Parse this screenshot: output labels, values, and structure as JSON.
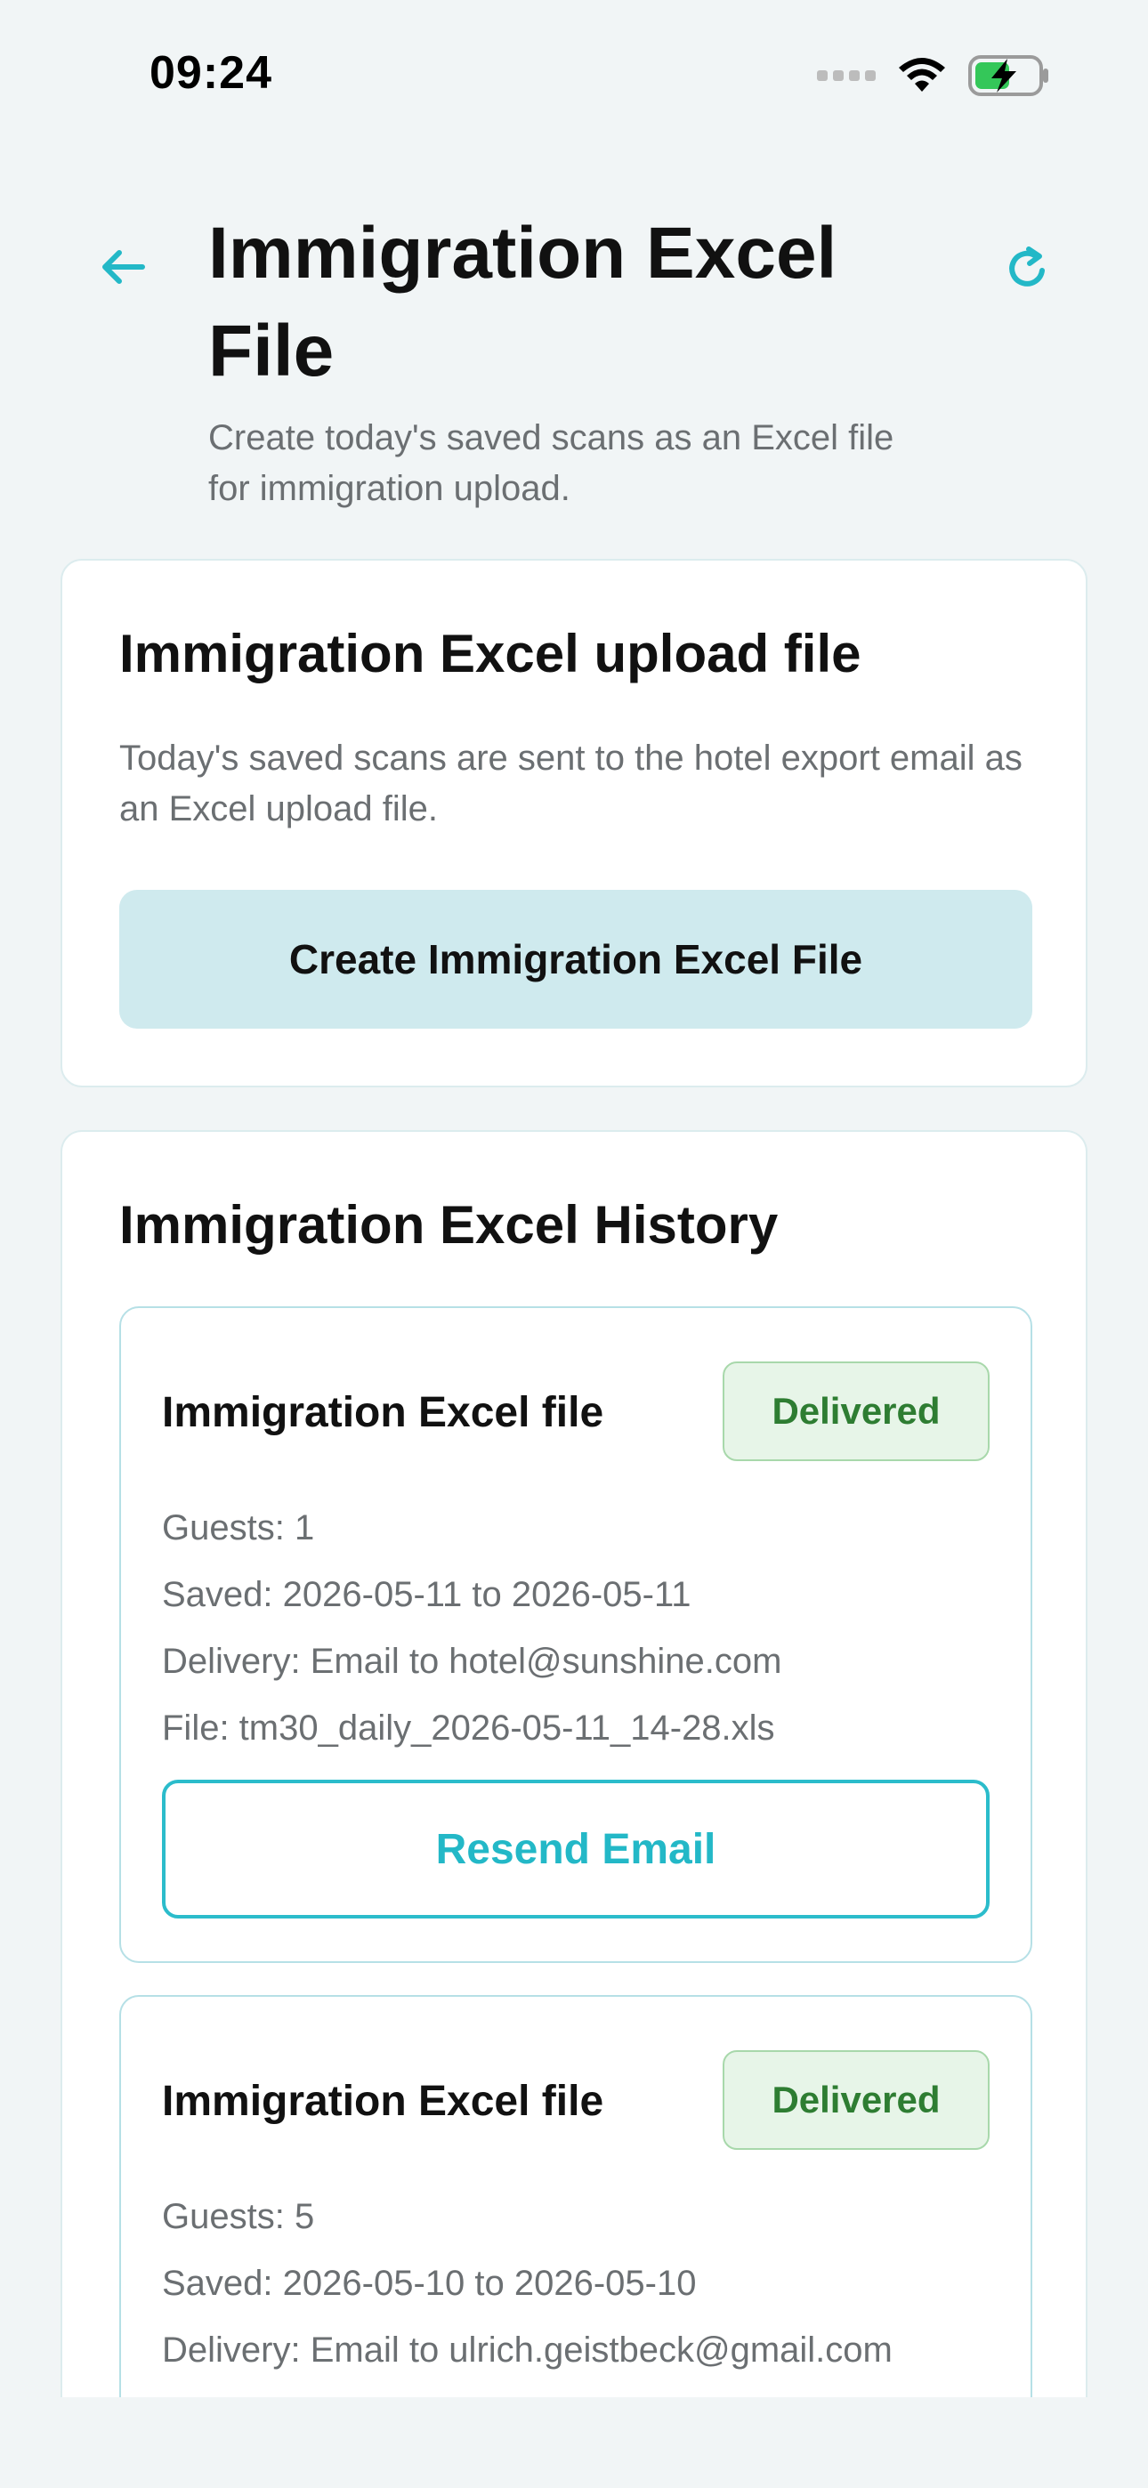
{
  "status_bar": {
    "time": "09:24",
    "icons": [
      "signal-dots-icon",
      "wifi-icon",
      "battery-charging-icon"
    ]
  },
  "header": {
    "title": "Immigration Excel File",
    "subtitle": "Create today's saved scans as an Excel file for immigration upload.",
    "back_icon": "arrow-left-icon",
    "refresh_icon": "refresh-icon",
    "accent_color": "#23b8c7"
  },
  "upload_card": {
    "title": "Immigration Excel upload file",
    "description": "Today's saved scans are sent to the hotel export email as an Excel upload file.",
    "button_label": "Create Immigration Excel File"
  },
  "history": {
    "title": "Immigration Excel History",
    "items": [
      {
        "title": "Immigration Excel file",
        "status": "Delivered",
        "guests": "Guests: 1",
        "saved": "Saved: 2026-05-11 to 2026-05-11",
        "delivery": "Delivery: Email to hotel@sunshine.com",
        "file": "File: tm30_daily_2026-05-11_14-28.xls",
        "action_label": "Resend Email"
      },
      {
        "title": "Immigration Excel file",
        "status": "Delivered",
        "guests": "Guests: 5",
        "saved": "Saved: 2026-05-10 to 2026-05-10",
        "delivery": "Delivery: Email to ulrich.geistbeck@gmail.com"
      }
    ]
  }
}
